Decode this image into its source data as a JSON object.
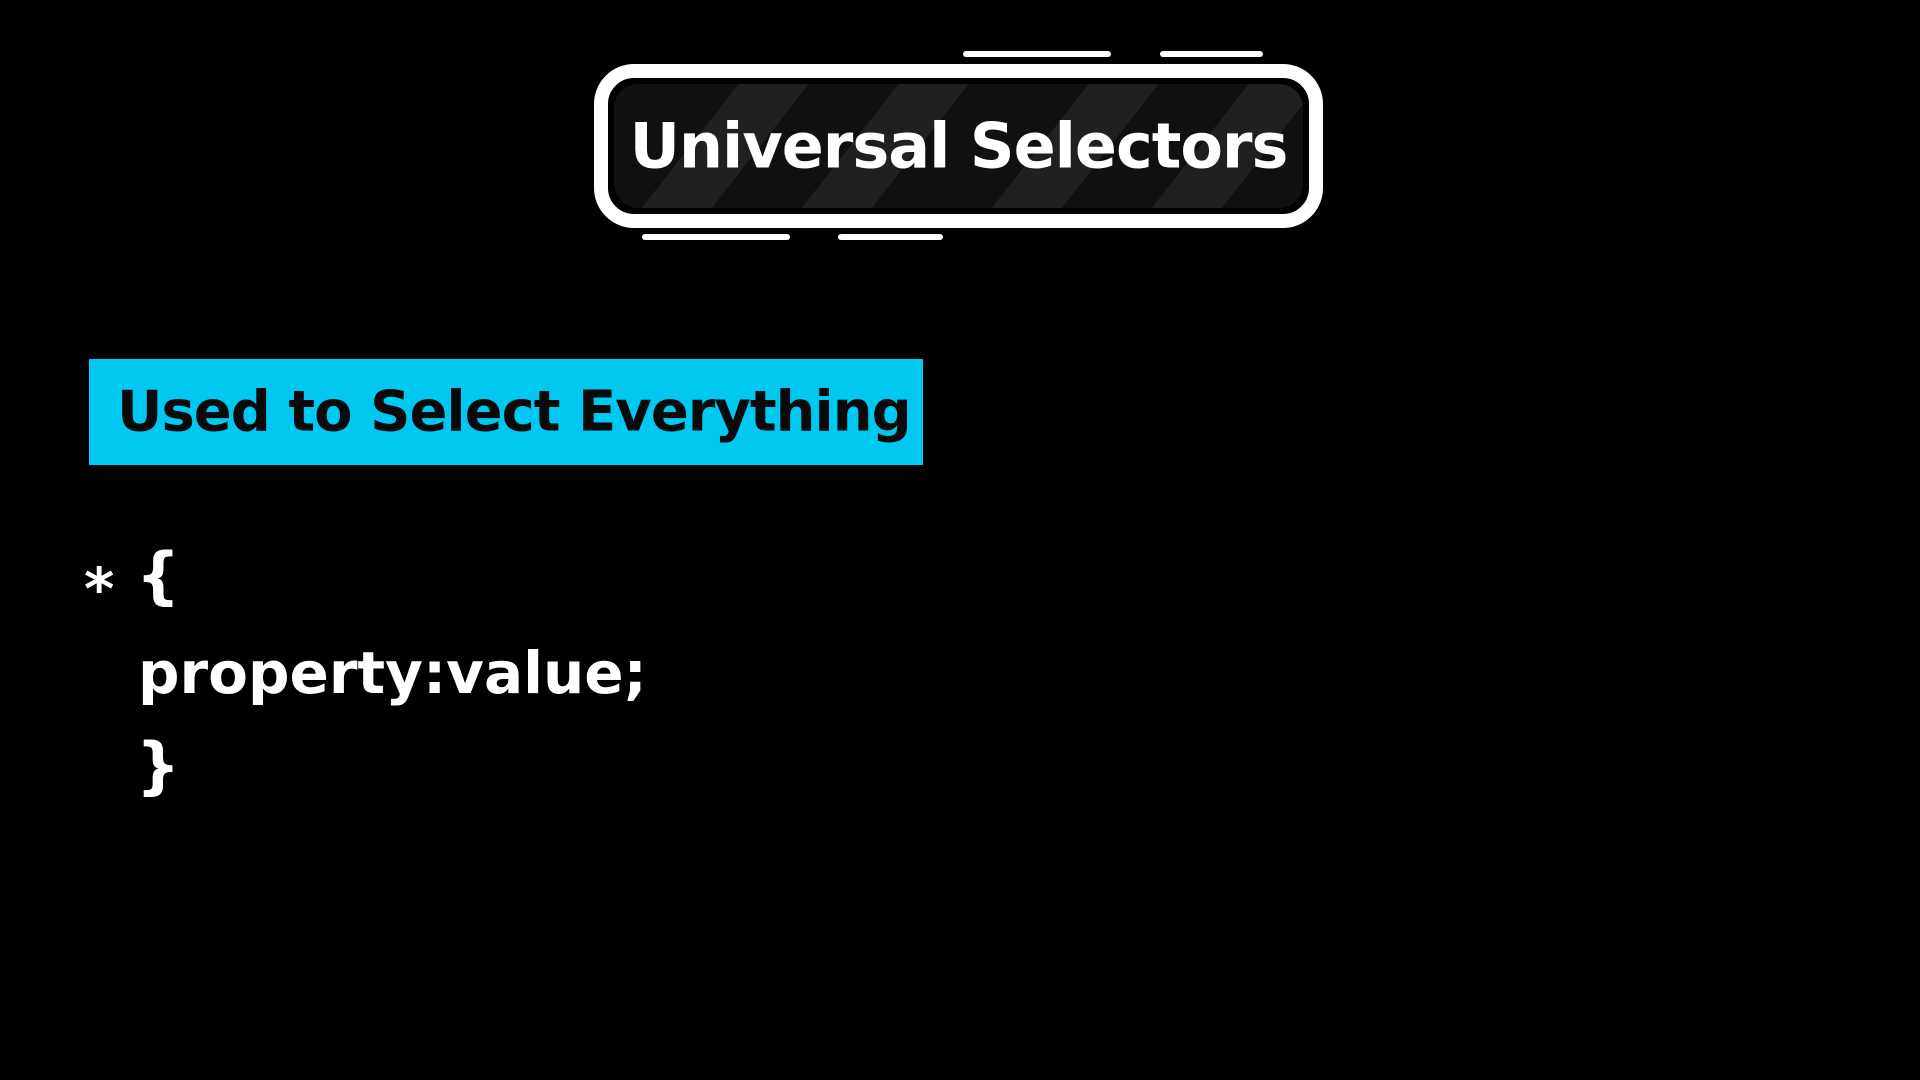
{
  "title": "Universal Selectors",
  "highlight": "Used to Select Everything",
  "code": {
    "selector": "*",
    "open_brace": "{",
    "declaration": "property:value;",
    "close_brace": "}"
  },
  "colors": {
    "background": "#000000",
    "badge_border": "#ffffff",
    "highlight": "#00c8f0",
    "highlight_text": "#0a0a0a",
    "code_text": "#ffffff"
  }
}
